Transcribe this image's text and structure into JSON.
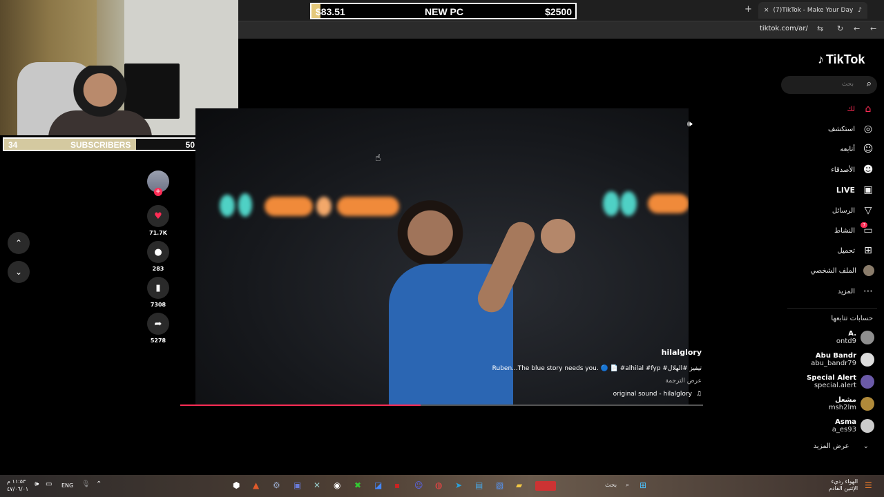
{
  "overlays": {
    "subscribers": {
      "current": "34",
      "label": "SUBSCRIBERS",
      "goal": "50",
      "progress": 0.68
    },
    "donation_goal": {
      "current": "$83.51",
      "label": "NEW PC",
      "goal": "$2500",
      "progress": 0.033
    }
  },
  "browser": {
    "tab_title": "(7)TikTok - Make Your Day",
    "tab_close": "×",
    "new_tab": "+",
    "url": "tiktok.com/ar/"
  },
  "tiktok": {
    "logo_text": "TikTok",
    "search_placeholder": "بحث",
    "nav": [
      {
        "label": "لك",
        "icon": "home-icon"
      },
      {
        "label": "استكشف",
        "icon": "compass-icon"
      },
      {
        "label": "أتابعه",
        "icon": "following-icon"
      },
      {
        "label": "الأصدقاء",
        "icon": "friends-icon"
      },
      {
        "label": "LIVE",
        "icon": "live-icon"
      },
      {
        "label": "الرسائل",
        "icon": "messages-icon"
      },
      {
        "label": "النشاط",
        "icon": "activity-icon",
        "badge": "7"
      },
      {
        "label": "تحميل",
        "icon": "upload-icon"
      },
      {
        "label": "الملف الشخصي",
        "icon": "profile-avatar"
      },
      {
        "label": "المزيد",
        "icon": "more-icon"
      }
    ],
    "following_title": "حسابات تتابعها",
    "following": [
      {
        "name": "A.",
        "handle": "ontd9"
      },
      {
        "name": "Abu Bandr",
        "handle": "abu_bandr79"
      },
      {
        "name": "Special Alert",
        "handle": "special.alert"
      },
      {
        "name": "مشعل",
        "handle": "msh2lm"
      },
      {
        "name": "Asma",
        "handle": "a_es93"
      }
    ],
    "see_more": "عرض المزيد",
    "video": {
      "username": "hilalglory",
      "description": "Ruben...The blue story needs you. 🔵 📄 #alhilal #fyp #تيفيز #الهلال",
      "translate": "عرض الترجمة",
      "sound": "original sound - hilalglory",
      "progress": 0.46
    },
    "actions": {
      "likes": "71.7K",
      "comments": "283",
      "saves": "7308",
      "shares": "5278"
    }
  },
  "taskbar": {
    "time": "١١:٥٣ م",
    "date": "٤٧/٠٦/٠١",
    "lang": "ENG",
    "search": "بحث",
    "weather_line1": "الهواء رديء",
    "weather_line2": "الإثنين القادم"
  },
  "colors": {
    "accent": "#fe2c55",
    "sub_fill": "#d4c9a0",
    "goal_fill": "#e5c97b"
  }
}
